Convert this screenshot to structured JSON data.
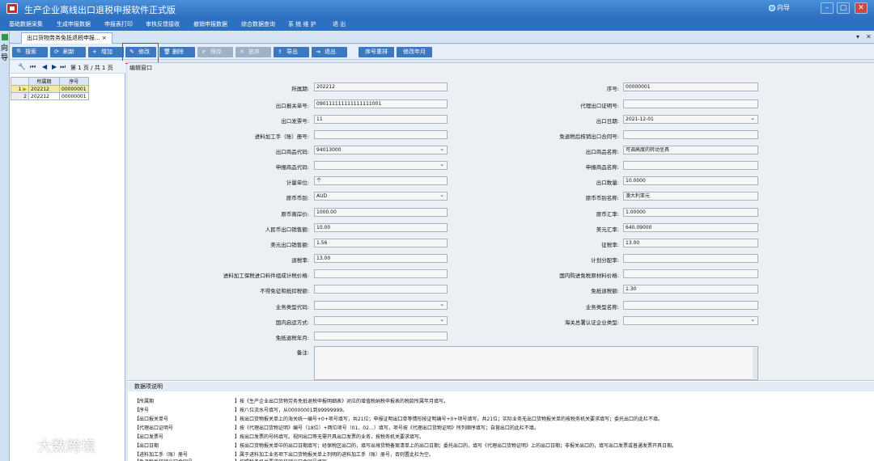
{
  "app": {
    "title": "生产企业离线出口退税申报软件正式版",
    "guide_link": "向导",
    "window_controls": [
      "–",
      "▢",
      "✕"
    ]
  },
  "menu": [
    "基础数据采集",
    "生成申报数据",
    "申报表打印",
    "审核反馈接收",
    "撤销申报数据",
    "综合数据查询",
    "系 统 维 护",
    "退 出"
  ],
  "side_guide": {
    "label": "向导"
  },
  "doc_tab": {
    "label": "出口货物劳务免抵退税申报...",
    "close": "×",
    "pin": "▾",
    "close_all": "✕"
  },
  "toolbar": {
    "buttons": [
      {
        "label": "搜索",
        "icon": "search-icon",
        "glyph": "🔍",
        "enabled": true
      },
      {
        "label": "刷新",
        "icon": "refresh-icon",
        "glyph": "⟳",
        "enabled": true
      },
      {
        "label": "增加",
        "icon": "plus-icon",
        "glyph": "+",
        "enabled": true
      },
      {
        "label": "修改",
        "icon": "edit-icon",
        "glyph": "✎",
        "enabled": true
      },
      {
        "label": "删除",
        "icon": "trash-icon",
        "glyph": "🗑",
        "enabled": true
      },
      {
        "label": "保存",
        "icon": "check-icon",
        "glyph": "✔",
        "enabled": false
      },
      {
        "label": "放弃",
        "icon": "x-icon",
        "glyph": "✕",
        "enabled": false
      },
      {
        "label": "导出",
        "icon": "export-icon",
        "glyph": "⇪",
        "enabled": true
      },
      {
        "label": "退出",
        "icon": "exit-icon",
        "glyph": "⇥",
        "enabled": true
      },
      {
        "label": "序号重排",
        "icon": "",
        "glyph": "",
        "enabled": true
      },
      {
        "label": "修改年月",
        "icon": "",
        "glyph": "",
        "enabled": true
      }
    ]
  },
  "nav": {
    "wrench": "🔧",
    "first": "⏮",
    "prev": "◀",
    "next": "▶",
    "last": "⏭",
    "page_text": "第 1 页 / 共 1 页"
  },
  "grid": {
    "columns": [
      "所属期",
      "序号"
    ],
    "rows": [
      {
        "num": "1",
        "marker": "▶",
        "period": "202212",
        "seq": "00000001",
        "selected": true
      },
      {
        "num": "2",
        "marker": "",
        "period": "202212",
        "seq": "00000001",
        "selected": false
      }
    ]
  },
  "edit_panel": {
    "title": "编辑窗口",
    "left_fields": [
      {
        "label": "所属期:",
        "value": "202212",
        "combo": false
      },
      {
        "label": "出口报关单号:",
        "value": "090111111111111111001",
        "combo": false
      },
      {
        "label": "出口发票号:",
        "value": "11",
        "combo": false
      },
      {
        "label": "进料加工手（账）册号:",
        "value": "",
        "combo": false
      },
      {
        "label": "出口商品代码:",
        "value": "94013000",
        "combo": true
      },
      {
        "label": "申报商品代码:",
        "value": "",
        "combo": true
      },
      {
        "label": "计量单位:",
        "value": "个",
        "combo": false
      },
      {
        "label": "原币币别:",
        "value": "AUD",
        "combo": true
      },
      {
        "label": "原币离岸价:",
        "value": "1000.00",
        "combo": false
      },
      {
        "label": "人民币出口销售额:",
        "value": "10.00",
        "combo": false
      },
      {
        "label": "美元出口销售额:",
        "value": "1.56",
        "combo": false
      },
      {
        "label": "退税率:",
        "value": "13.00",
        "combo": false
      },
      {
        "label": "进料加工保税进口料件组成计税价格:",
        "value": "",
        "combo": false
      },
      {
        "label": "不得免征和抵扣税额:",
        "value": "",
        "combo": false
      },
      {
        "label": "业务类型代码:",
        "value": "",
        "combo": true
      },
      {
        "label": "国内启运方式:",
        "value": "",
        "combo": true
      },
      {
        "label": "免抵退税年月:",
        "value": "",
        "combo": false
      }
    ],
    "right_fields": [
      {
        "label": "序号:",
        "value": "00000001",
        "combo": false
      },
      {
        "label": "代理出口证明号:",
        "value": "",
        "combo": false
      },
      {
        "label": "出口日期:",
        "value": "2021-12-01",
        "combo": true
      },
      {
        "label": "免退税后核销出口合同号:",
        "value": "",
        "combo": false
      },
      {
        "label": "出口商品名称:",
        "value": "可调高度的转动坐具",
        "combo": false
      },
      {
        "label": "申报商品名称:",
        "value": "",
        "combo": false
      },
      {
        "label": "出口数量:",
        "value": "10.0000",
        "combo": false
      },
      {
        "label": "原币币别名称:",
        "value": "澳大利亚元",
        "combo": false
      },
      {
        "label": "原币汇率:",
        "value": "1.00000",
        "combo": false
      },
      {
        "label": "美元汇率:",
        "value": "640.09000",
        "combo": false
      },
      {
        "label": "征税率:",
        "value": "13.00",
        "combo": false
      },
      {
        "label": "计划分配率:",
        "value": "",
        "combo": false
      },
      {
        "label": "国内购进免税原材料价格:",
        "value": "",
        "combo": false
      },
      {
        "label": "免抵退税额:",
        "value": "1.30",
        "combo": false
      },
      {
        "label": "业务类型名称:",
        "value": "",
        "combo": false
      },
      {
        "label": "海关总署认证企业类型:",
        "value": "",
        "combo": true
      }
    ],
    "remark_label": "备注:"
  },
  "help": {
    "title": "数据项说明",
    "lines": [
      {
        "name": "【所属期",
        "desc": "】按《生产企业出口货物劳务免抵退税申报明细表》对应的增值税纳税申报表的税款所属年月填写。"
      },
      {
        "name": "【序号",
        "desc": "】按八位流水号填写，从00000001到99999999。"
      },
      {
        "name": "【出口报关单号",
        "desc": "】按出口货物报关单上的海关统一编号+0+项号填写，共21位；申报证明出口单等情形按证明编号+0+项号填写，共21位；实际业务无出口货物报关单的按税务机关要求填写；委托出口的此栏不填。"
      },
      {
        "name": "【代理出口证明号",
        "desc": "】按《代理出口货物证明》编号（18位）+两位项号（01、02…）填写，项号按《代理出口货物证明》所列顺序填写；自营出口的此栏不填。"
      },
      {
        "name": "【出口发票号",
        "desc": "】按出口发票的号码填写。视同出口等无需开具出口发票的业务，按税务机关要求填写。"
      },
      {
        "name": "【出口日期",
        "desc": "】按出口货物报关单中的出口日期填写；经保税区出口的，填写出境货物备案清单上的出口日期；委托出口的，填写《代理出口货物证明》上的出口日期；非报关出口的，填写出口发票或普通发票开具日期。"
      },
      {
        "name": "【进料加工手（账）册号",
        "desc": "】属于进料加工业务项下出口货物报关单上列明的进料加工手（账）册号，否则置此栏为空。"
      },
      {
        "name": "【免退税后核销出口合同号",
        "desc": "】按照税务机关要求的核销出口合同号填写。"
      }
    ]
  },
  "watermark": {
    "text": "大数跨境"
  }
}
